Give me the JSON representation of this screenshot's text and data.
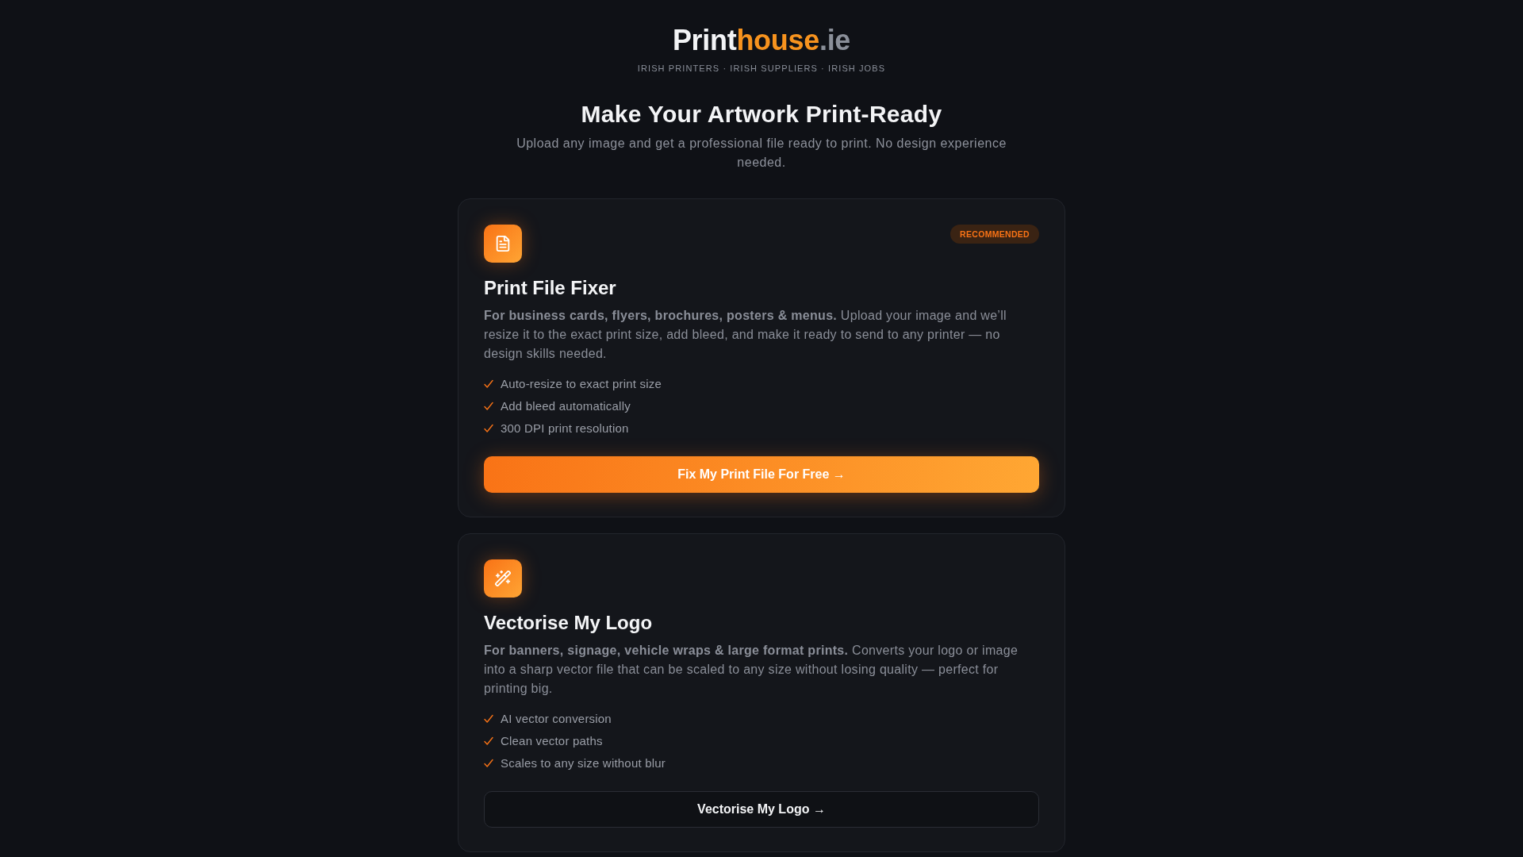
{
  "logo": [
    "Print",
    "house",
    ".ie"
  ],
  "tagline": "IRISH PRINTERS · IRISH SUPPLIERS · IRISH JOBS",
  "heading": "Make Your Artwork Print-Ready",
  "subtitle": "Upload any image and get a professional file ready to print. No design experience needed.",
  "cards": [
    {
      "badge": "RECOMMENDED",
      "title": "Print File Fixer",
      "description": "**For business cards, flyers, brochures, posters & menus.** Upload your image and we’ll resize it to the exact print size, add bleed, and make it ready to send to any printer — no design skills needed.",
      "features": [
        "Auto-resize to exact print size",
        "Add bleed automatically",
        "300 DPI print resolution"
      ],
      "button": {
        "label": "Fix My Print File For Free →",
        "kind": "primary"
      }
    },
    {
      "title": "Vectorise My Logo",
      "description": "**For banners, signage, vehicle wraps & large format prints.** Converts your logo or image into a sharp vector file that can be scaled to any size without losing quality — perfect for printing big.",
      "features": [
        "AI vector conversion",
        "Clean vector paths",
        "Scales to any size without blur"
      ],
      "button": {
        "label": "Vectorise My Logo →",
        "kind": "secondary"
      }
    }
  ]
}
